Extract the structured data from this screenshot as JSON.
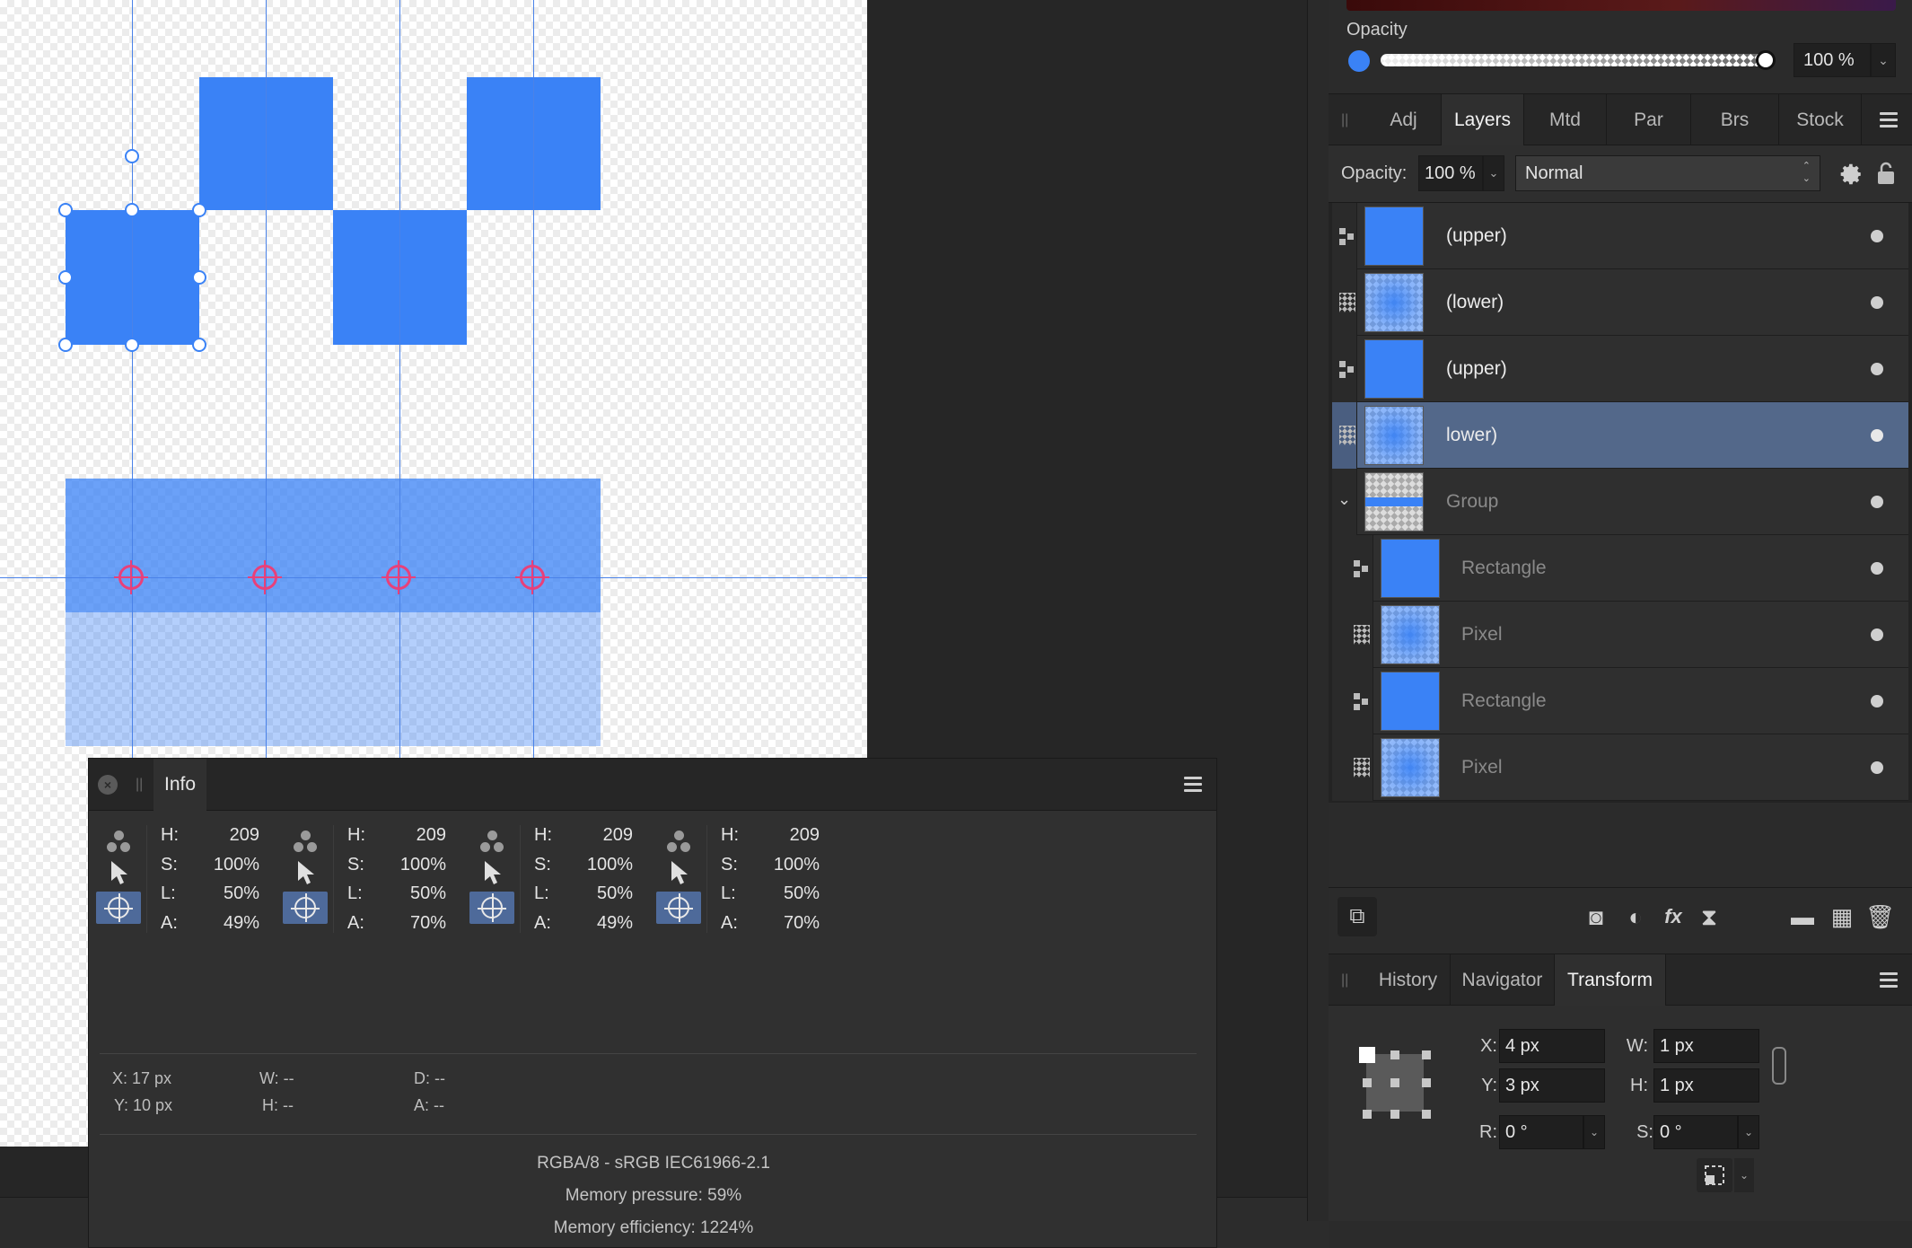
{
  "info_panel": {
    "tab": "Info",
    "samplers": [
      {
        "h_label": "H:",
        "h": "209",
        "s_label": "S:",
        "s": "100%",
        "l_label": "L:",
        "l": "50%",
        "a_label": "A:",
        "a": "49%"
      },
      {
        "h_label": "H:",
        "h": "209",
        "s_label": "S:",
        "s": "100%",
        "l_label": "L:",
        "l": "50%",
        "a_label": "A:",
        "a": "70%"
      },
      {
        "h_label": "H:",
        "h": "209",
        "s_label": "S:",
        "s": "100%",
        "l_label": "L:",
        "l": "50%",
        "a_label": "A:",
        "a": "49%"
      },
      {
        "h_label": "H:",
        "h": "209",
        "s_label": "S:",
        "s": "100%",
        "l_label": "L:",
        "l": "50%",
        "a_label": "A:",
        "a": "70%"
      }
    ],
    "cursor": {
      "x": "X: 17 px",
      "y": "Y: 10 px",
      "w": "W: --",
      "h": "H: --",
      "d": "D: --",
      "a": "A: --"
    },
    "color_format": "RGBA/8 - sRGB IEC61966-2.1",
    "memory_pressure": "Memory pressure: 59%",
    "memory_efficiency": "Memory efficiency: 1224%"
  },
  "color_panel": {
    "opacity_label": "Opacity",
    "opacity_value": "100 %",
    "opacity_fraction": 1.0,
    "swatch_color": "#3a82f6"
  },
  "studio_tabs": [
    "Adj",
    "Layers",
    "Mtd",
    "Par",
    "Brs",
    "Stock"
  ],
  "studio_active_tab": "Layers",
  "layer_options": {
    "opacity_label": "Opacity:",
    "opacity_value": "100 %",
    "blend_mode": "Normal"
  },
  "layers": [
    {
      "name": "(upper)",
      "type": "vector",
      "thumb": "solid",
      "dim": false,
      "selected": false
    },
    {
      "name": "(lower)",
      "type": "pixel",
      "thumb": "pixel",
      "dim": false,
      "selected": false
    },
    {
      "name": "(upper)",
      "type": "vector",
      "thumb": "solid",
      "dim": false,
      "selected": false
    },
    {
      "name": "lower)",
      "type": "pixel",
      "thumb": "pixel",
      "dim": false,
      "selected": true
    },
    {
      "name": "Group",
      "type": "group",
      "thumb": "group",
      "dim": true,
      "selected": false
    },
    {
      "name": "Rectangle",
      "type": "vector",
      "thumb": "solid",
      "dim": true,
      "selected": false,
      "child": true
    },
    {
      "name": "Pixel",
      "type": "pixel",
      "thumb": "pixel",
      "dim": true,
      "selected": false,
      "child": true
    },
    {
      "name": "Rectangle",
      "type": "vector",
      "thumb": "solid",
      "dim": true,
      "selected": false,
      "child": true
    },
    {
      "name": "Pixel",
      "type": "pixel",
      "thumb": "pixel",
      "dim": true,
      "selected": false,
      "child": true
    }
  ],
  "bottom_tabs": [
    "History",
    "Navigator",
    "Transform"
  ],
  "bottom_active_tab": "Transform",
  "transform": {
    "x_label": "X:",
    "x": "4 px",
    "y_label": "Y:",
    "y": "3 px",
    "w_label": "W:",
    "w": "1 px",
    "h_label": "H:",
    "h": "1 px",
    "r_label": "R:",
    "r": "0 °",
    "s_label": "S:",
    "s": "0 °"
  },
  "colors": {
    "accent_blue": "#3a82f6",
    "sampler_pink": "#e8407a",
    "selected_layer": "#53688a"
  }
}
